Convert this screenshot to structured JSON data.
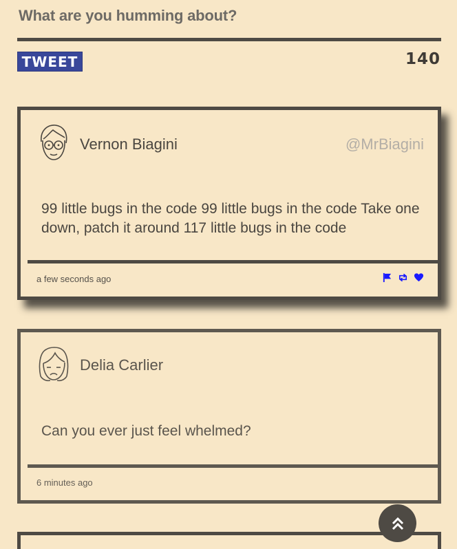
{
  "compose": {
    "placeholder": "What are you humming about?",
    "tweet_button_label": "TWEET",
    "char_count": "140"
  },
  "feed": {
    "tweets": [
      {
        "name": "Vernon Biagini",
        "handle": "@MrBiagini",
        "message": "99 little bugs in the code 99 little bugs in the code Take one down, patch it around 117 little bugs in the code",
        "time": "a few seconds ago",
        "avatar_icon": "avatar-glasses-icon",
        "actions": [
          "flag-icon",
          "retweet-icon",
          "heart-icon"
        ]
      },
      {
        "name": "Delia Carlier",
        "message": "Can you ever just feel whelmed?",
        "time": "6 minutes ago",
        "avatar_icon": "avatar-girl-icon"
      }
    ]
  },
  "colors": {
    "background": "#f8e7c7",
    "border": "#4e4a44",
    "tweet_button": "#39479a",
    "action_icons": "#1a1aff"
  },
  "scroll_top_icon": "double-chevron-up-icon"
}
